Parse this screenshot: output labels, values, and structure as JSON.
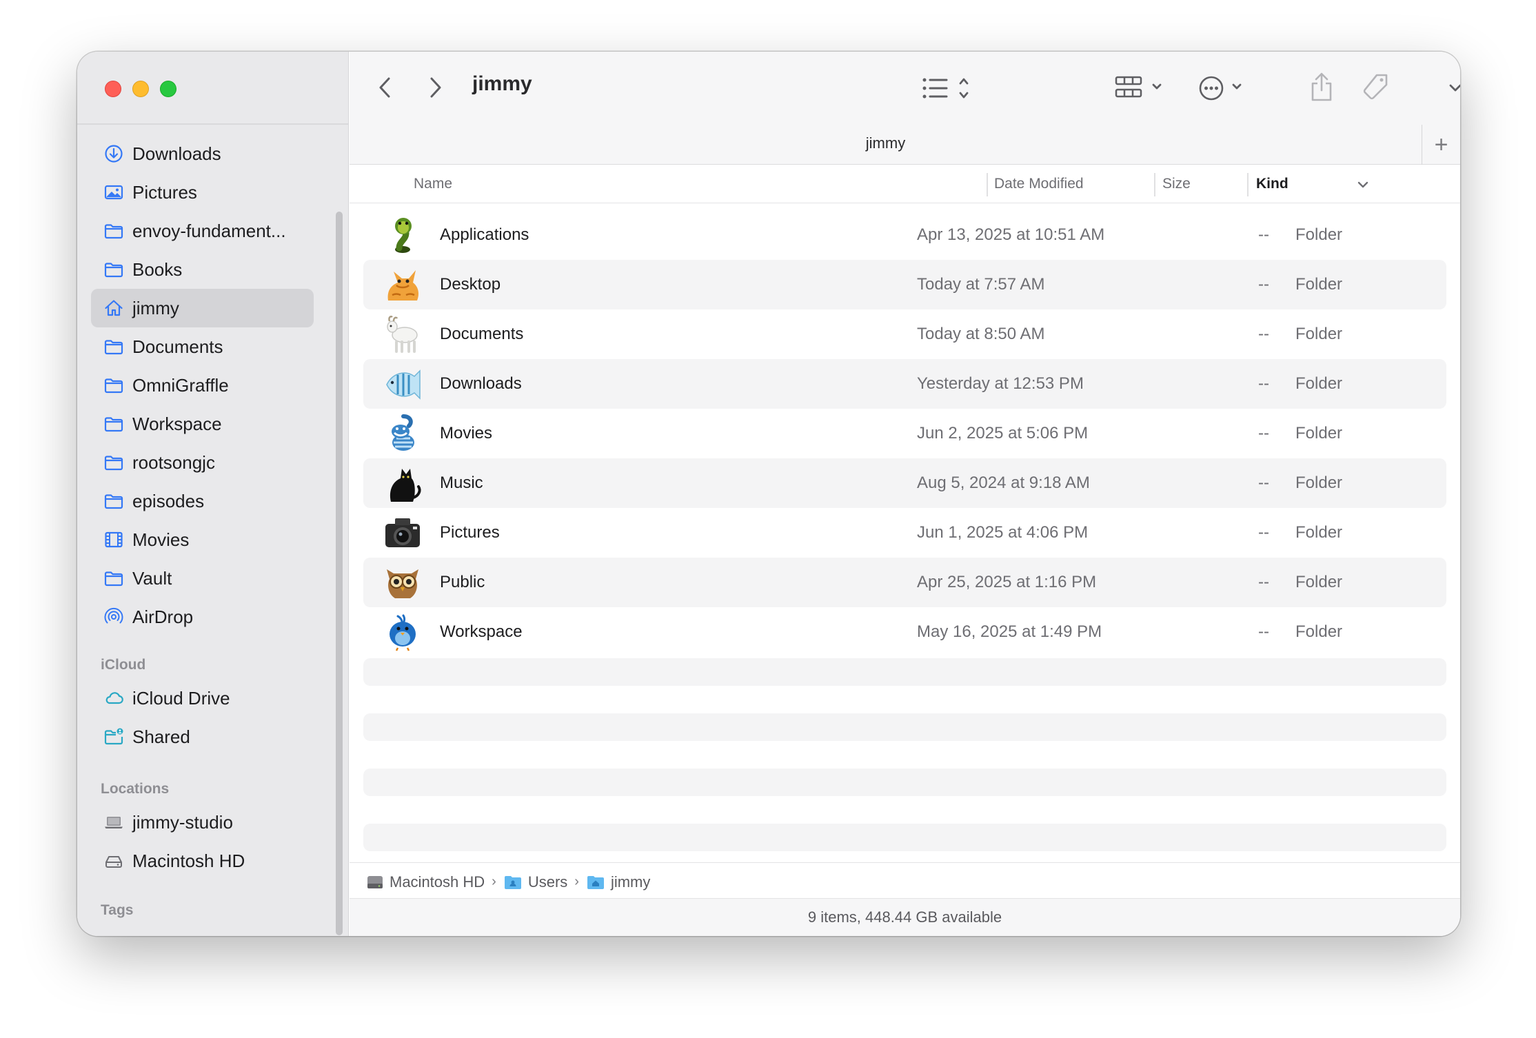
{
  "window": {
    "title": "jimmy"
  },
  "sidebar": {
    "favorites": [
      {
        "label": "Downloads",
        "icon": "download-circle-icon"
      },
      {
        "label": "Pictures",
        "icon": "photo-icon"
      },
      {
        "label": "envoy-fundament...",
        "icon": "folder-icon"
      },
      {
        "label": "Books",
        "icon": "folder-icon"
      },
      {
        "label": "jimmy",
        "icon": "home-icon",
        "selected": true
      },
      {
        "label": "Documents",
        "icon": "folder-icon"
      },
      {
        "label": "OmniGraffle",
        "icon": "folder-icon"
      },
      {
        "label": "Workspace",
        "icon": "folder-icon"
      },
      {
        "label": "rootsongjc",
        "icon": "folder-icon"
      },
      {
        "label": "episodes",
        "icon": "folder-icon"
      },
      {
        "label": "Movies",
        "icon": "film-icon"
      },
      {
        "label": "Vault",
        "icon": "folder-icon"
      },
      {
        "label": "AirDrop",
        "icon": "airdrop-icon"
      }
    ],
    "icloud_header": "iCloud",
    "icloud": [
      {
        "label": "iCloud Drive",
        "icon": "cloud-icon"
      },
      {
        "label": "Shared",
        "icon": "shared-folder-icon"
      }
    ],
    "locations_header": "Locations",
    "locations": [
      {
        "label": "jimmy-studio",
        "icon": "laptop-icon"
      },
      {
        "label": "Macintosh HD",
        "icon": "disk-icon"
      }
    ],
    "tags_header": "Tags"
  },
  "tab": {
    "label": "jimmy",
    "plus": "+"
  },
  "columns": {
    "name": "Name",
    "date": "Date Modified",
    "size": "Size",
    "kind": "Kind"
  },
  "rows": [
    {
      "name": "Applications",
      "date": "Apr 13, 2025 at 10:51 AM",
      "size": "--",
      "kind": "Folder",
      "icon": "snake-icon"
    },
    {
      "name": "Desktop",
      "date": "Today at 7:57 AM",
      "size": "--",
      "kind": "Folder",
      "icon": "cat-icon"
    },
    {
      "name": "Documents",
      "date": "Today at 8:50 AM",
      "size": "--",
      "kind": "Folder",
      "icon": "goat-icon"
    },
    {
      "name": "Downloads",
      "date": "Yesterday at 12:53 PM",
      "size": "--",
      "kind": "Folder",
      "icon": "fish-icon"
    },
    {
      "name": "Movies",
      "date": "Jun 2, 2025 at 5:06 PM",
      "size": "--",
      "kind": "Folder",
      "icon": "cheshire-cat-icon"
    },
    {
      "name": "Music",
      "date": "Aug 5, 2024 at 9:18 AM",
      "size": "--",
      "kind": "Folder",
      "icon": "black-cat-icon"
    },
    {
      "name": "Pictures",
      "date": "Jun 1, 2025 at 4:06 PM",
      "size": "--",
      "kind": "Folder",
      "icon": "camera-icon"
    },
    {
      "name": "Public",
      "date": "Apr 25, 2025 at 1:16 PM",
      "size": "--",
      "kind": "Folder",
      "icon": "owl-icon"
    },
    {
      "name": "Workspace",
      "date": "May 16, 2025 at 1:49 PM",
      "size": "--",
      "kind": "Folder",
      "icon": "bird-icon"
    }
  ],
  "pathbar": {
    "items": [
      "Macintosh HD",
      "Users",
      "jimmy"
    ],
    "separator": "›"
  },
  "status": "9 items, 448.44 GB available",
  "colors": {
    "accent": "#3478f6",
    "sidebar_bg": "#e9e9eb",
    "selected_bg": "#d4d4d7"
  }
}
